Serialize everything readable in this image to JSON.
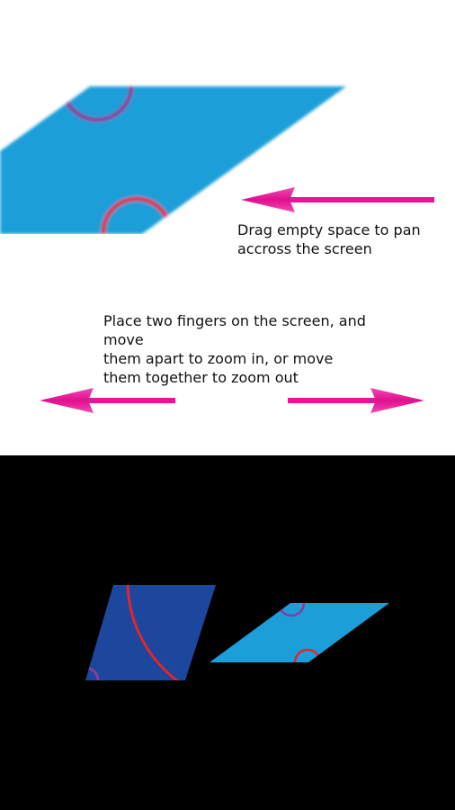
{
  "tutorial": {
    "pan_hint": "Drag empty space to pan\naccross the screen",
    "zoom_hint": "Place two fingers on the screen, and move\nthem apart to zoom in, or move\nthem together to zoom out"
  },
  "colors": {
    "arrow": "#ee1199",
    "tile_light_blue": "#1c9ed9",
    "tile_dark_blue": "#1d479c",
    "arc_red": "#e0262e",
    "arc_purple": "#8a3b9a",
    "background_top": "#ffffff",
    "background_bottom": "#000000"
  },
  "icons": {
    "pan_arrow": "arrow-left-icon",
    "zoom_left_arrow": "arrow-left-icon",
    "zoom_right_arrow": "arrow-right-icon"
  }
}
